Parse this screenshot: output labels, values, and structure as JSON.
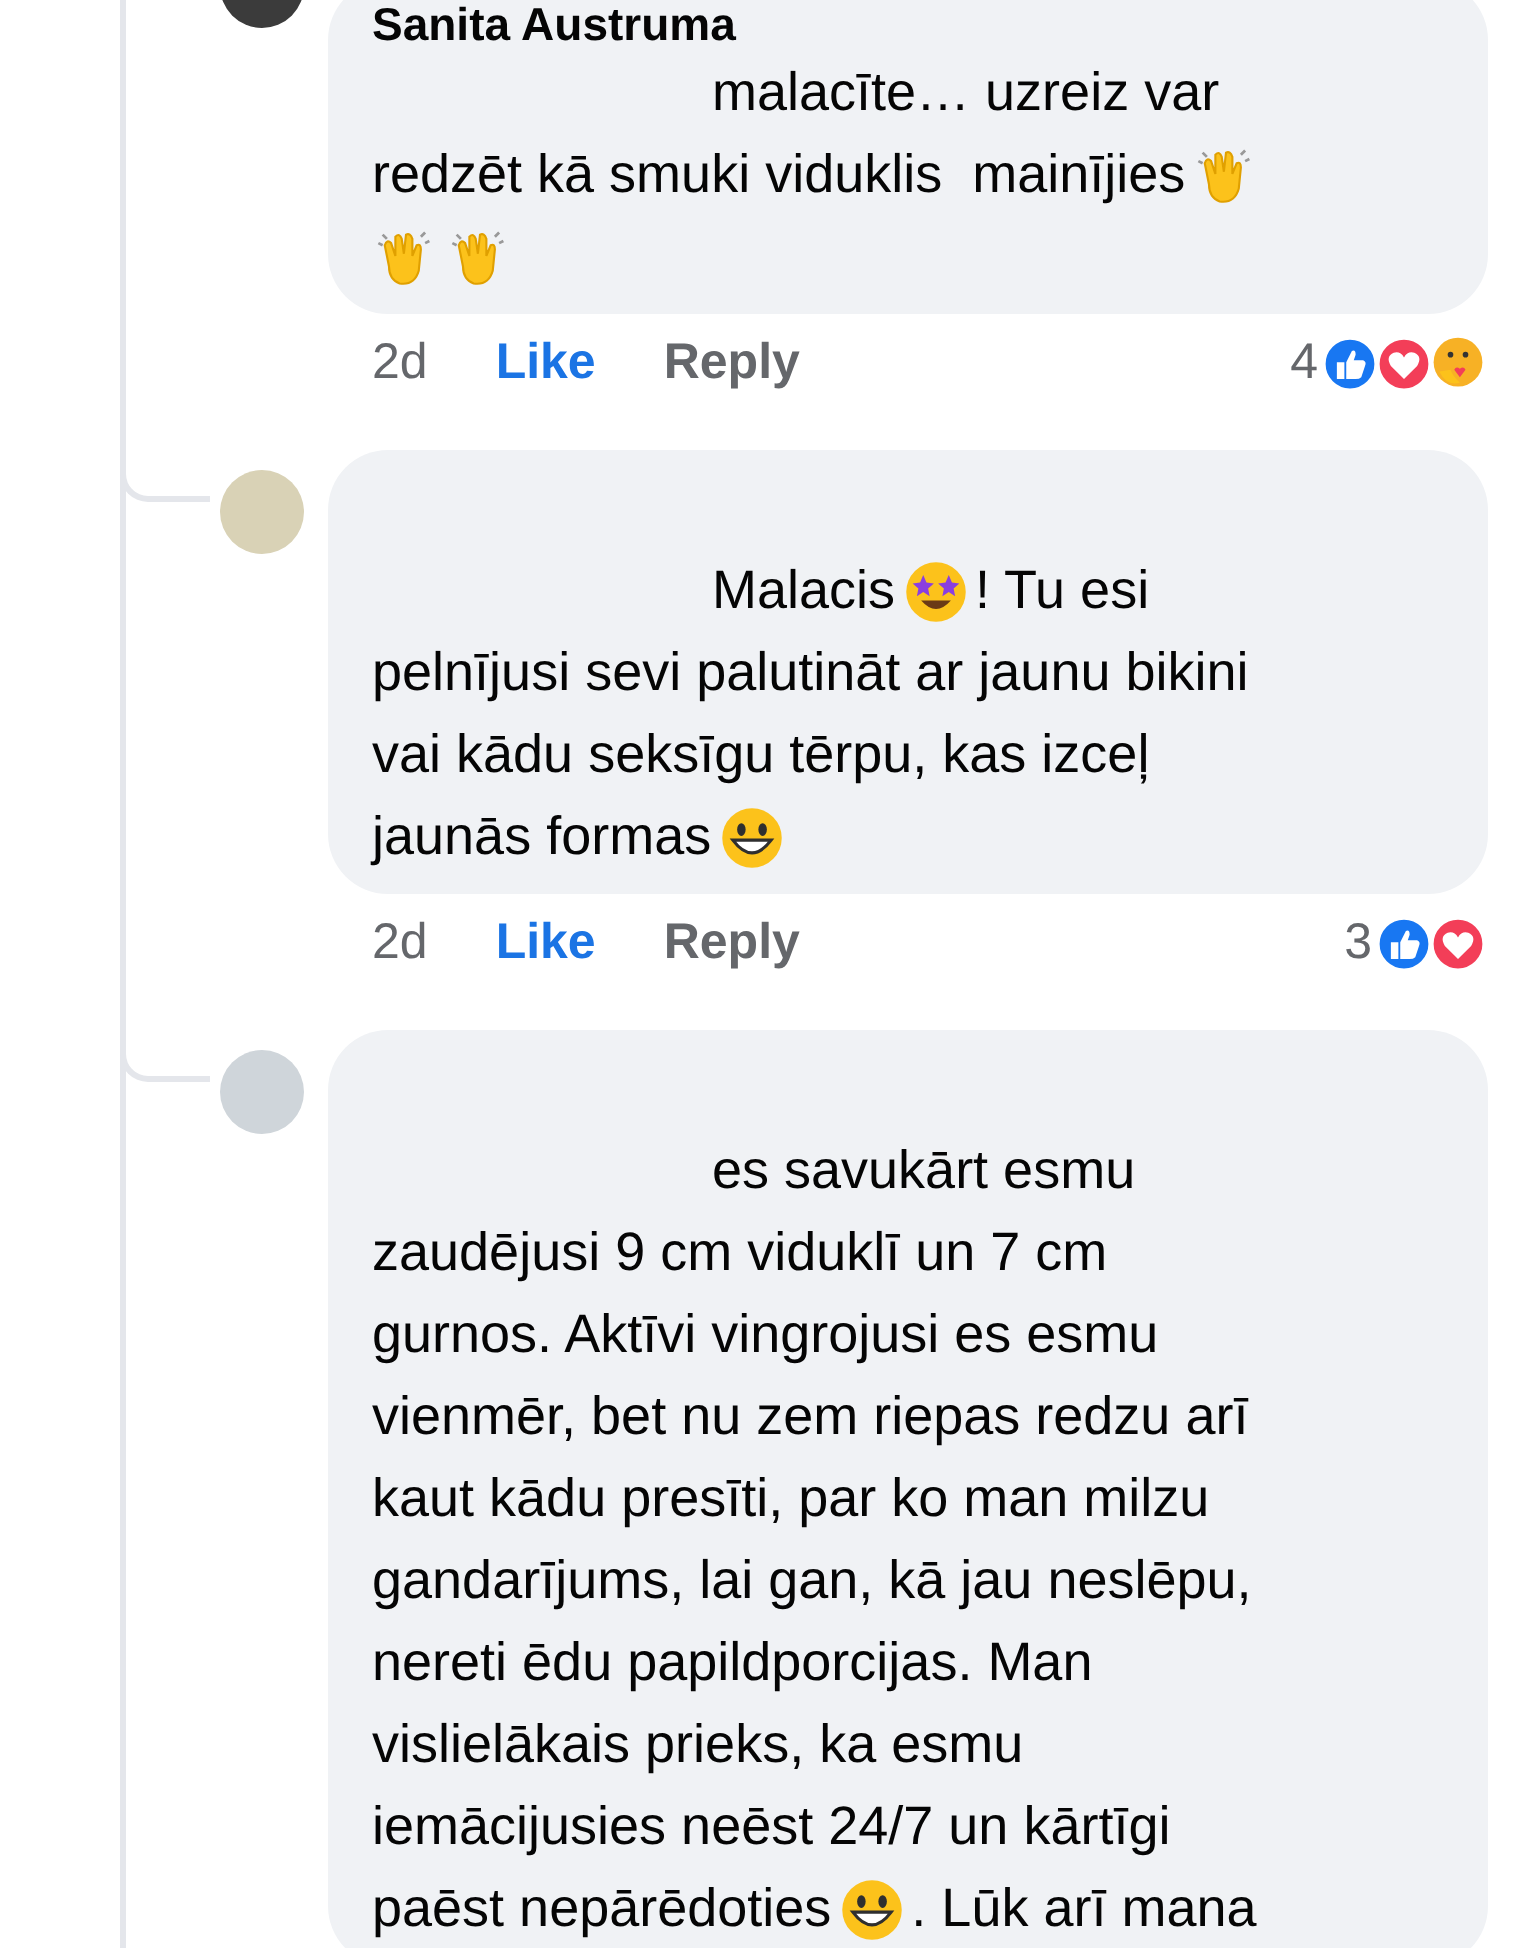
{
  "comments": [
    {
      "author": "Sanita Austruma",
      "lines": [
        [
          {
            "kind": "text",
            "text": "malacīte… uzreiz var"
          }
        ],
        [
          {
            "kind": "text",
            "text": "redzēt kā smuki viduklis  mainījies"
          },
          {
            "kind": "clap"
          }
        ],
        [
          {
            "kind": "clap"
          },
          {
            "kind": "clap"
          }
        ]
      ],
      "time": "2d",
      "like": "Like",
      "reply": "Reply",
      "reaction_count": "4",
      "reactions": [
        {
          "kind": "like"
        },
        {
          "kind": "love"
        },
        {
          "kind": "care"
        }
      ]
    },
    {
      "lines": [
        [
          {
            "kind": "text",
            "text": "Malacis"
          },
          {
            "kind": "star_struck"
          },
          {
            "kind": "text",
            "text": "! Tu esi"
          }
        ],
        [
          {
            "kind": "text",
            "text": "pelnījusi sevi palutināt ar jaunu bikini"
          }
        ],
        [
          {
            "kind": "text",
            "text": "vai kādu seksīgu tērpu, kas izceļ"
          }
        ],
        [
          {
            "kind": "text",
            "text": "jaunās formas"
          },
          {
            "kind": "grin"
          }
        ]
      ],
      "time": "2d",
      "like": "Like",
      "reply": "Reply",
      "reaction_count": "3",
      "reactions": [
        {
          "kind": "like"
        },
        {
          "kind": "love"
        }
      ]
    },
    {
      "lines": [
        [
          {
            "kind": "text",
            "text": "es savukārt esmu"
          }
        ],
        [
          {
            "kind": "text",
            "text": "zaudējusi 9 cm viduklī un 7 cm"
          }
        ],
        [
          {
            "kind": "text",
            "text": "gurnos. Aktīvi vingrojusi es esmu"
          }
        ],
        [
          {
            "kind": "text",
            "text": "vienmēr, bet nu zem riepas redzu arī"
          }
        ],
        [
          {
            "kind": "text",
            "text": "kaut kādu presīti, par ko man milzu"
          }
        ],
        [
          {
            "kind": "text",
            "text": "gandarījums, lai gan, kā jau neslēpu,"
          }
        ],
        [
          {
            "kind": "text",
            "text": "nereti ēdu papildporcijas. Man"
          }
        ],
        [
          {
            "kind": "text",
            "text": "vislielākais prieks, ka esmu"
          }
        ],
        [
          {
            "kind": "text",
            "text": "iemācijusies neēst 24/7 un kārtīgi"
          }
        ],
        [
          {
            "kind": "text",
            "text": "paēst nepārēdoties"
          },
          {
            "kind": "grin"
          },
          {
            "kind": "text",
            "text": ". Lūk arī mana"
          }
        ]
      ]
    }
  ]
}
